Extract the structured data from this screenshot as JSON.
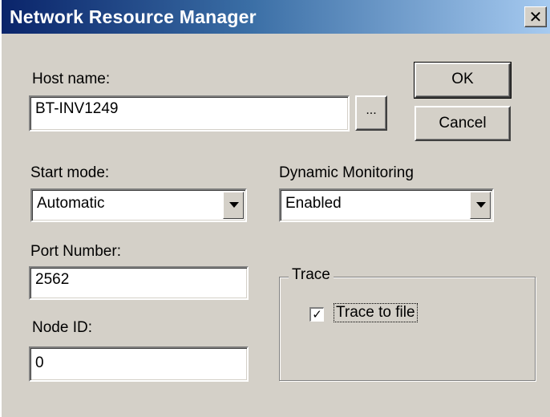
{
  "window": {
    "title": "Network Resource Manager",
    "close_glyph": "✕"
  },
  "host": {
    "label": "Host name:",
    "value": "BT-INV1249",
    "browse_label": "..."
  },
  "buttons": {
    "ok_label": "OK",
    "cancel_label": "Cancel"
  },
  "start_mode": {
    "label": "Start mode:",
    "selected": "Automatic"
  },
  "dynamic_monitoring": {
    "label": "Dynamic Monitoring",
    "selected": "Enabled"
  },
  "port": {
    "label": "Port Number:",
    "value": "2562"
  },
  "node": {
    "label": "Node ID:",
    "value": "0"
  },
  "trace": {
    "group_label": "Trace",
    "checkbox_label": "Trace to file",
    "checked": true,
    "check_glyph": "✓"
  },
  "colors": {
    "face": "#d4d0c8",
    "title_start": "#0a246a",
    "title_end": "#a6caf0"
  }
}
